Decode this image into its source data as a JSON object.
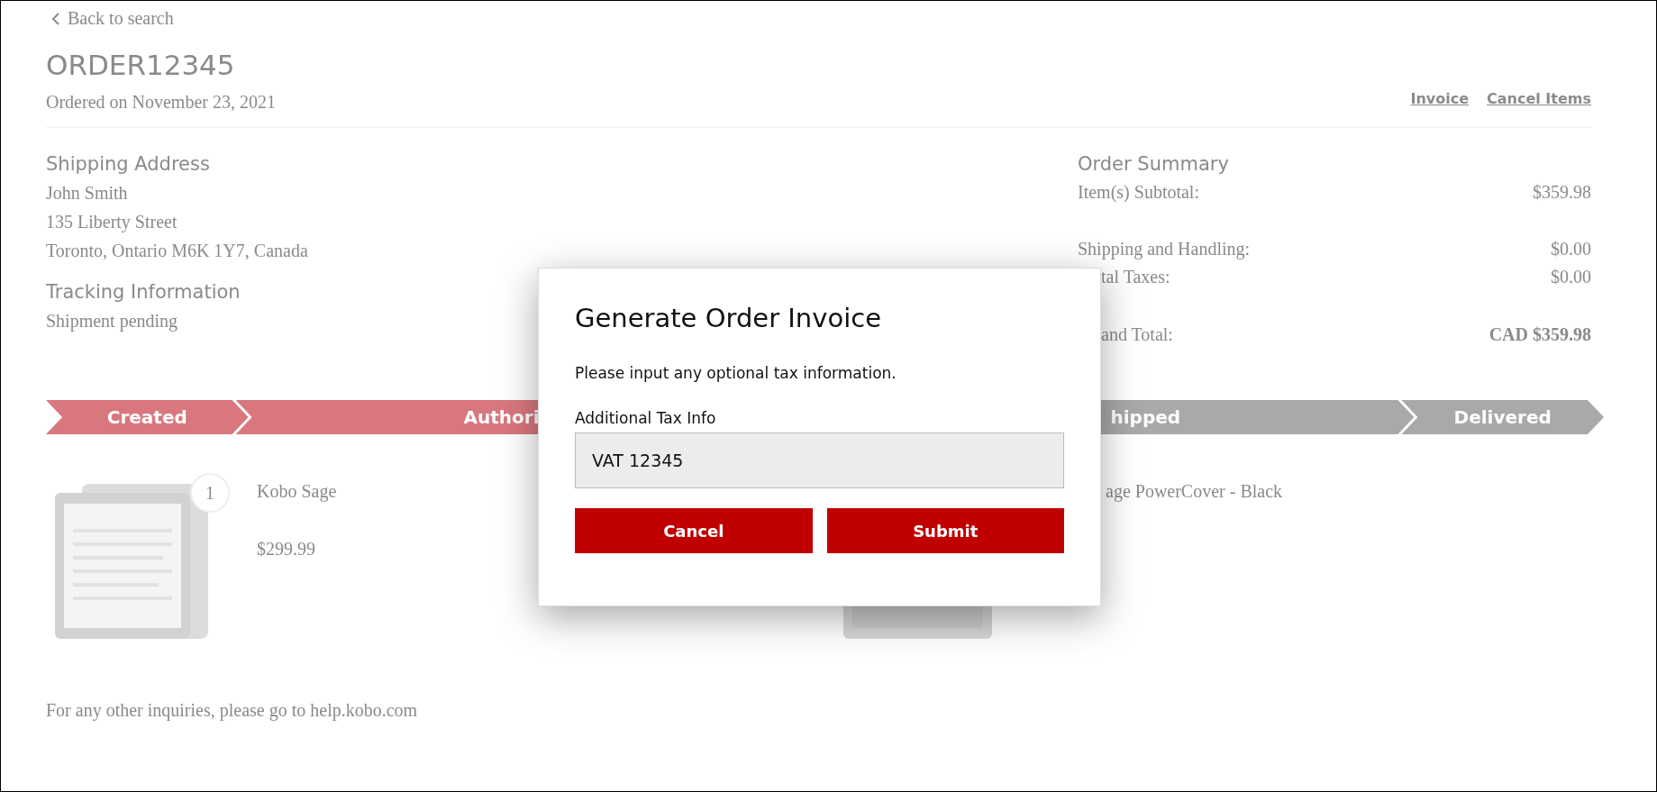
{
  "back_link": {
    "label": "Back to search"
  },
  "order": {
    "number": "ORDER12345",
    "date": "Ordered on November 23, 2021"
  },
  "actions": [
    "Invoice",
    "Cancel Items"
  ],
  "shipping": {
    "heading": "Shipping Address",
    "lines": [
      "John Smith",
      "135 Liberty Street",
      "Toronto, Ontario M6K 1Y7, Canada"
    ]
  },
  "tracking": {
    "heading": "Tracking Information",
    "status": "Shipment pending"
  },
  "summary": {
    "heading": "Order Summary",
    "groups": [
      [
        {
          "label": "Item(s) Subtotal:",
          "value": "$359.98",
          "kind": "line",
          "covered_start": false
        }
      ],
      [
        {
          "label": "Shipping and Handling:",
          "value": "$0.00",
          "kind": "line",
          "covered_start": false
        },
        {
          "label": "tal Taxes:",
          "value": "$0.00",
          "kind": "line",
          "covered_start": true
        }
      ],
      [
        {
          "label": "and Total:",
          "value": "CAD $359.98",
          "kind": "total",
          "covered_start": true
        }
      ]
    ]
  },
  "steps": [
    {
      "label": "Created",
      "done": true,
      "covered_start": false,
      "covered_end": false
    },
    {
      "label": "Authori",
      "done": true,
      "covered_start": false,
      "covered_end": true
    },
    {
      "label": "hipped",
      "done": false,
      "covered_start": true,
      "covered_end": false
    },
    {
      "label": "Delivered",
      "done": false,
      "covered_start": false,
      "covered_end": false
    }
  ],
  "products": [
    {
      "name": "Kobo Sage",
      "price": "$299.99",
      "quantity": "1",
      "covered_start": false
    },
    {
      "name": "age PowerCover - Black",
      "covered_start": true
    }
  ],
  "footer": "For any other inquiries, please go to help.kobo.com",
  "dialog": {
    "title": "Generate Order Invoice",
    "message": "Please input any optional tax information.",
    "field_label": "Additional Tax Info",
    "field_value": "VAT 12345",
    "buttons": [
      "Cancel",
      "Submit"
    ]
  }
}
